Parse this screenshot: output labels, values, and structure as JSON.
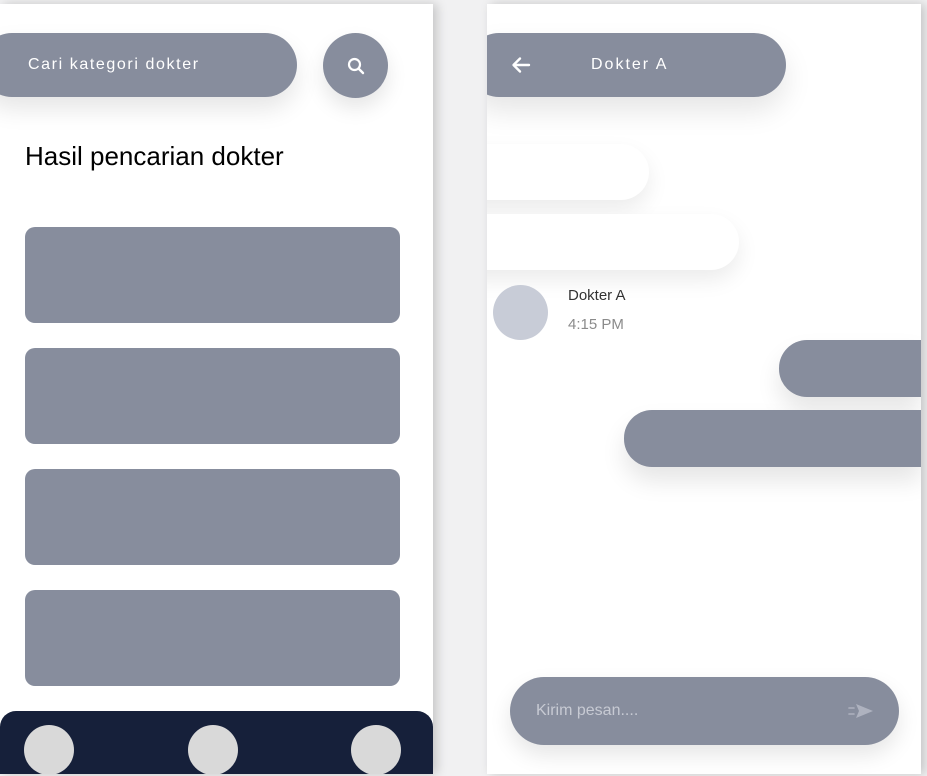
{
  "left_screen": {
    "search": {
      "placeholder": "Cari kategori dokter",
      "button_icon": "search-icon"
    },
    "title": "Hasil pencarian dokter",
    "results_count": 4,
    "bottom_nav": {
      "items": 3
    }
  },
  "right_screen": {
    "header": {
      "back_icon": "arrow-left-icon",
      "title": "Dokter A"
    },
    "message_meta": {
      "sender": "Dokter A",
      "time": "4:15 PM"
    },
    "composer": {
      "placeholder": "Kirim pesan....",
      "send_icon": "send-icon"
    }
  },
  "colors": {
    "primary_gray": "#878d9d",
    "nav_dark": "#16203a",
    "avatar": "#c8ccd7",
    "nav_button": "#d9d9d9",
    "background": "#f1f1f2"
  }
}
